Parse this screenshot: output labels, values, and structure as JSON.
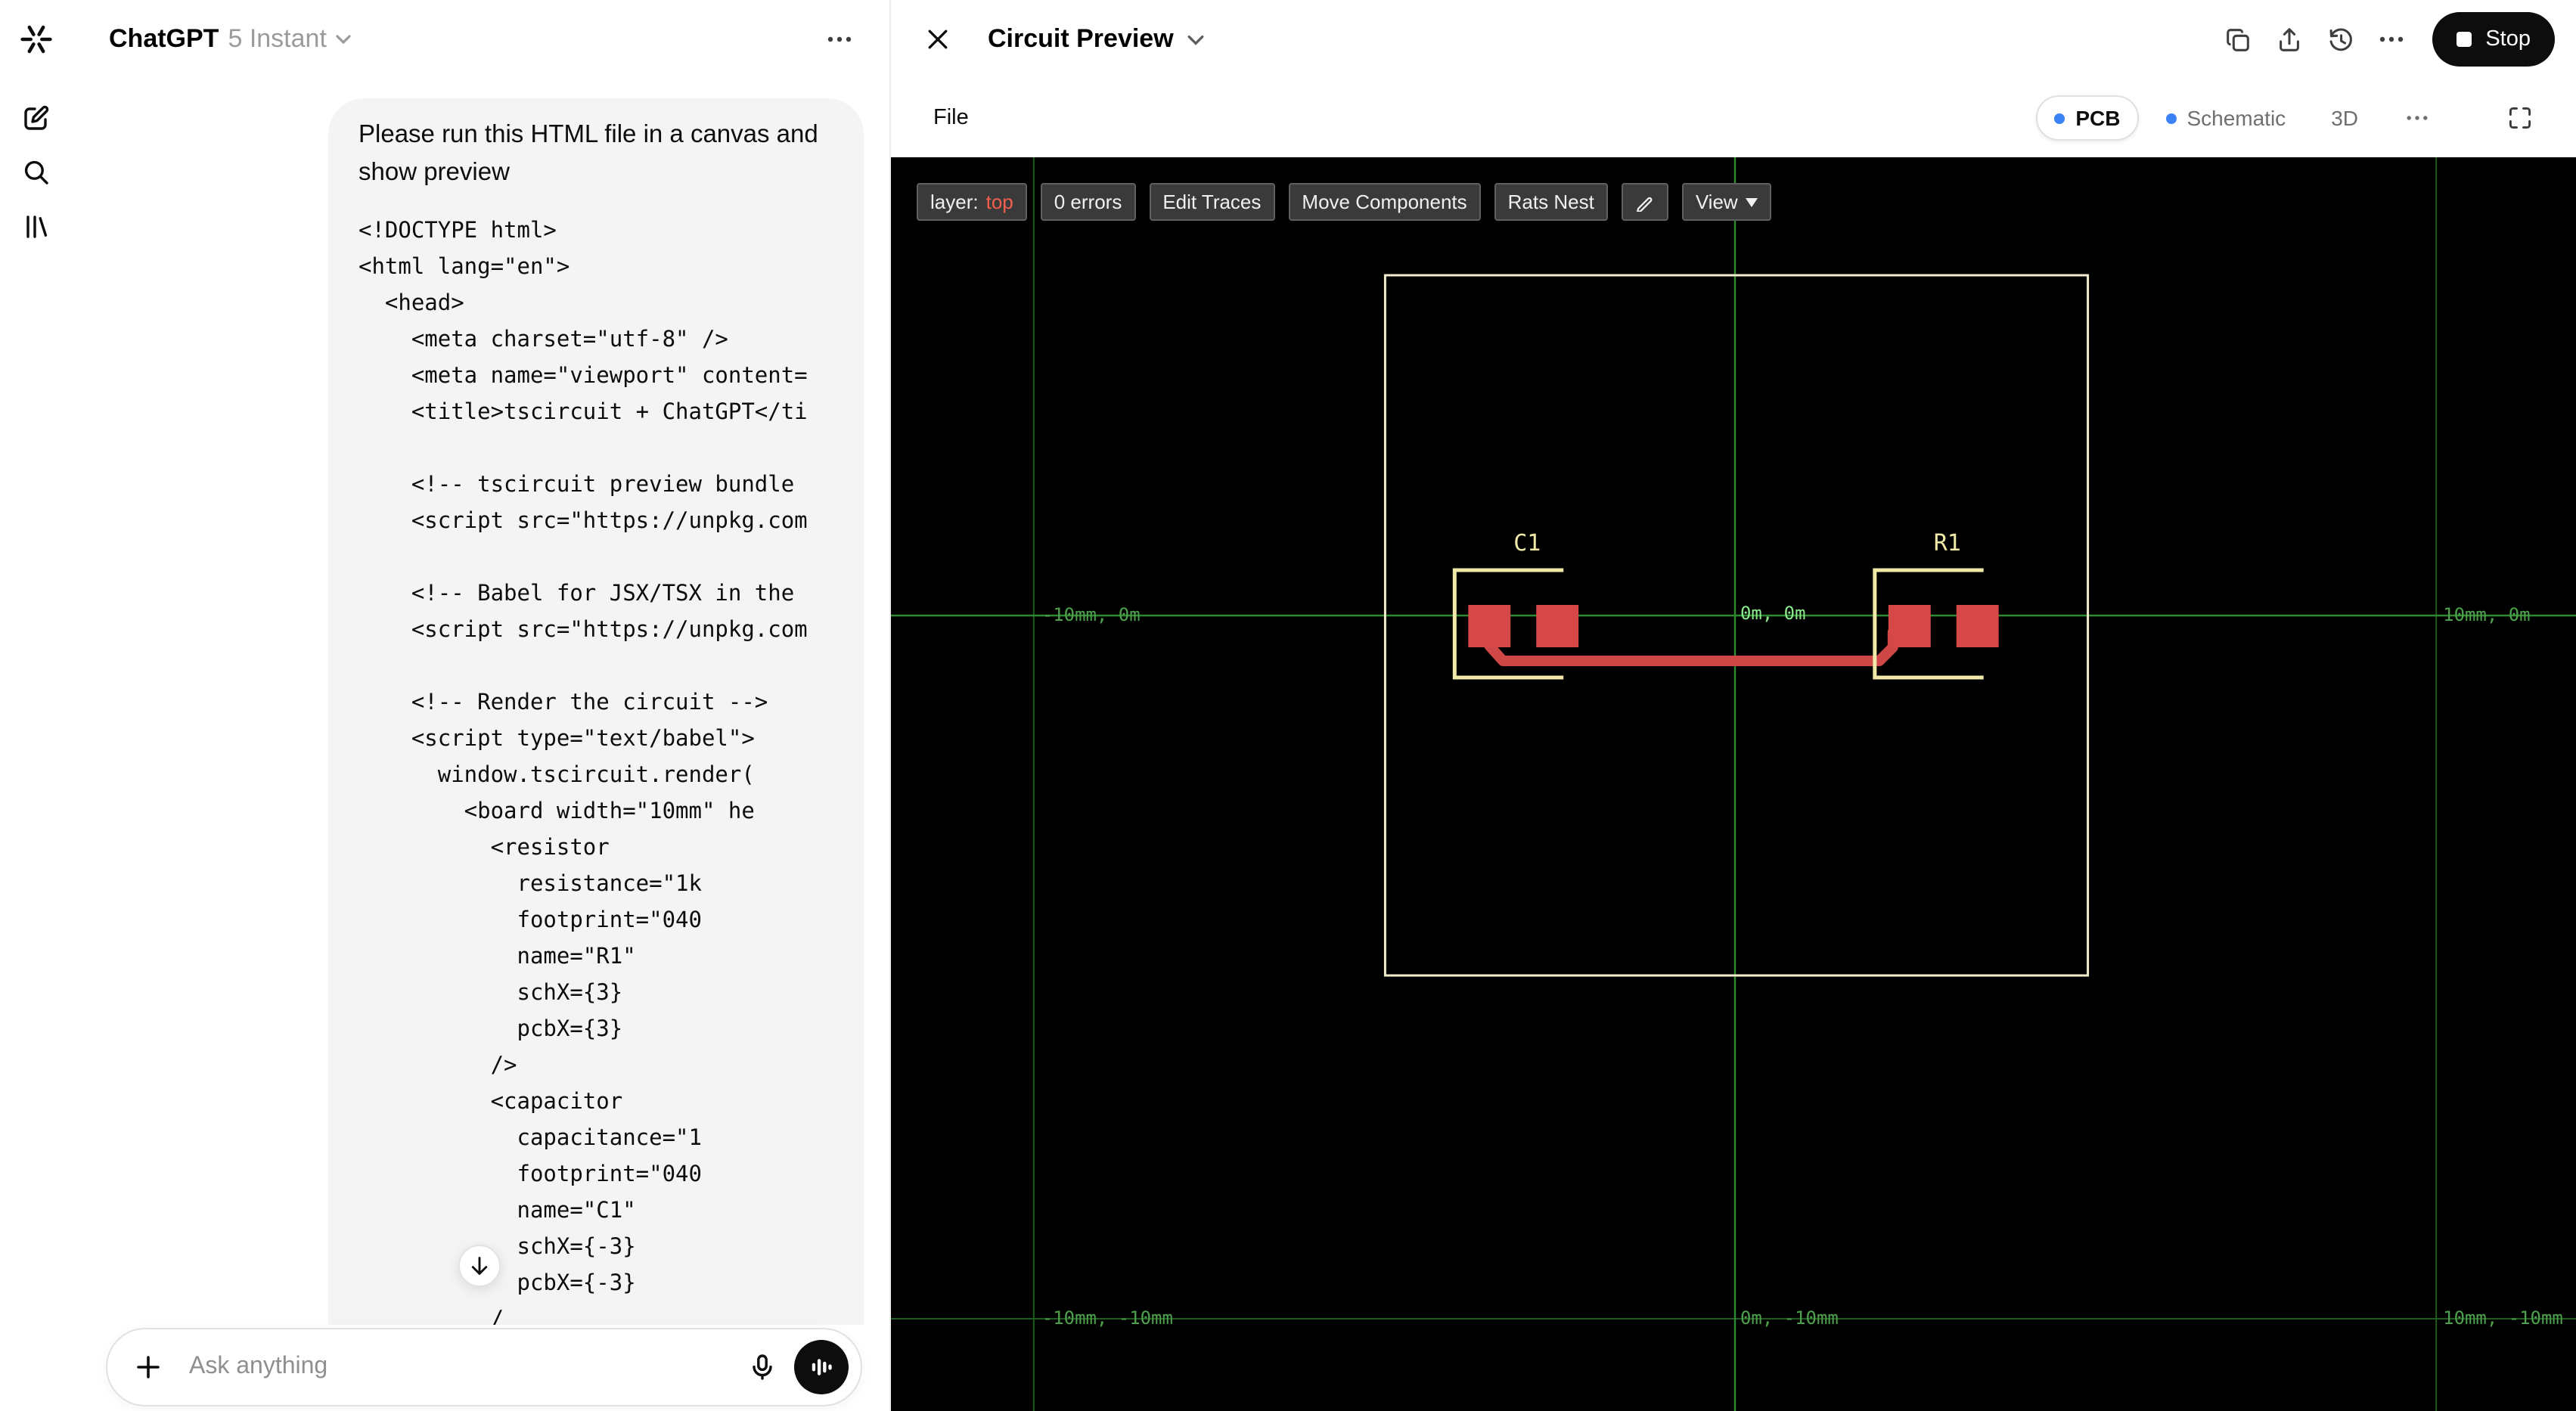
{
  "colors": {
    "accent_blue": "#3b82f6",
    "stop_button_bg": "#0d0d0d",
    "pcb_background": "#000000",
    "grid_line": "#1e5c1e",
    "grid_axis": "#2f8a2f",
    "coord_label": "#4ea04e",
    "coord_label_center": "#8ce98c",
    "board_outline": "#f1edcd",
    "silkscreen": "#f0e9a8",
    "pad": "#d64848",
    "trace": "#cf4747",
    "layer_top": "#f2604d"
  },
  "sidebar": {
    "icons": [
      "chatgpt-logo",
      "new-chat",
      "search",
      "library"
    ]
  },
  "chat": {
    "header": {
      "app_name": "ChatGPT",
      "model_name": "5 Instant"
    },
    "message": {
      "text": "Please run this HTML file in a canvas and show preview",
      "code": "<!DOCTYPE html>\n<html lang=\"en\">\n  <head>\n    <meta charset=\"utf-8\" />\n    <meta name=\"viewport\" content=\n    <title>tscircuit + ChatGPT</ti\n\n    <!-- tscircuit preview bundle\n    <script src=\"https://unpkg.com\n\n    <!-- Babel for JSX/TSX in the\n    <script src=\"https://unpkg.com\n\n    <!-- Render the circuit -->\n    <script type=\"text/babel\">\n      window.tscircuit.render(\n        <board width=\"10mm\" he\n          <resistor\n            resistance=\"1k\n            footprint=\"040\n            name=\"R1\"\n            schX={3}\n            pcbX={3}\n          />\n          <capacitor\n            capacitance=\"1\n            footprint=\"040\n            name=\"C1\"\n            schX={-3}\n            pcbX={-3}\n          /"
    },
    "composer": {
      "placeholder": "Ask anything"
    }
  },
  "canvas": {
    "title": "Circuit Preview",
    "file_menu": "File",
    "stop_label": "Stop",
    "tabs": [
      {
        "label": "PCB",
        "active": true
      },
      {
        "label": "Schematic",
        "active": false
      },
      {
        "label": "3D",
        "active": false
      }
    ]
  },
  "pcb": {
    "toolbar": {
      "layer_label": "layer:",
      "layer_value": "top",
      "buttons": [
        "0 errors",
        "Edit Traces",
        "Move Components",
        "Rats Nest"
      ],
      "view_label": "View"
    },
    "components": [
      {
        "name": "C1"
      },
      {
        "name": "R1"
      }
    ],
    "coords": [
      "-10mm, 0m",
      "0m, 0m",
      "10mm, 0m",
      "-10mm, -10mm",
      "0m, -10mm",
      "10mm, -10mm"
    ]
  }
}
